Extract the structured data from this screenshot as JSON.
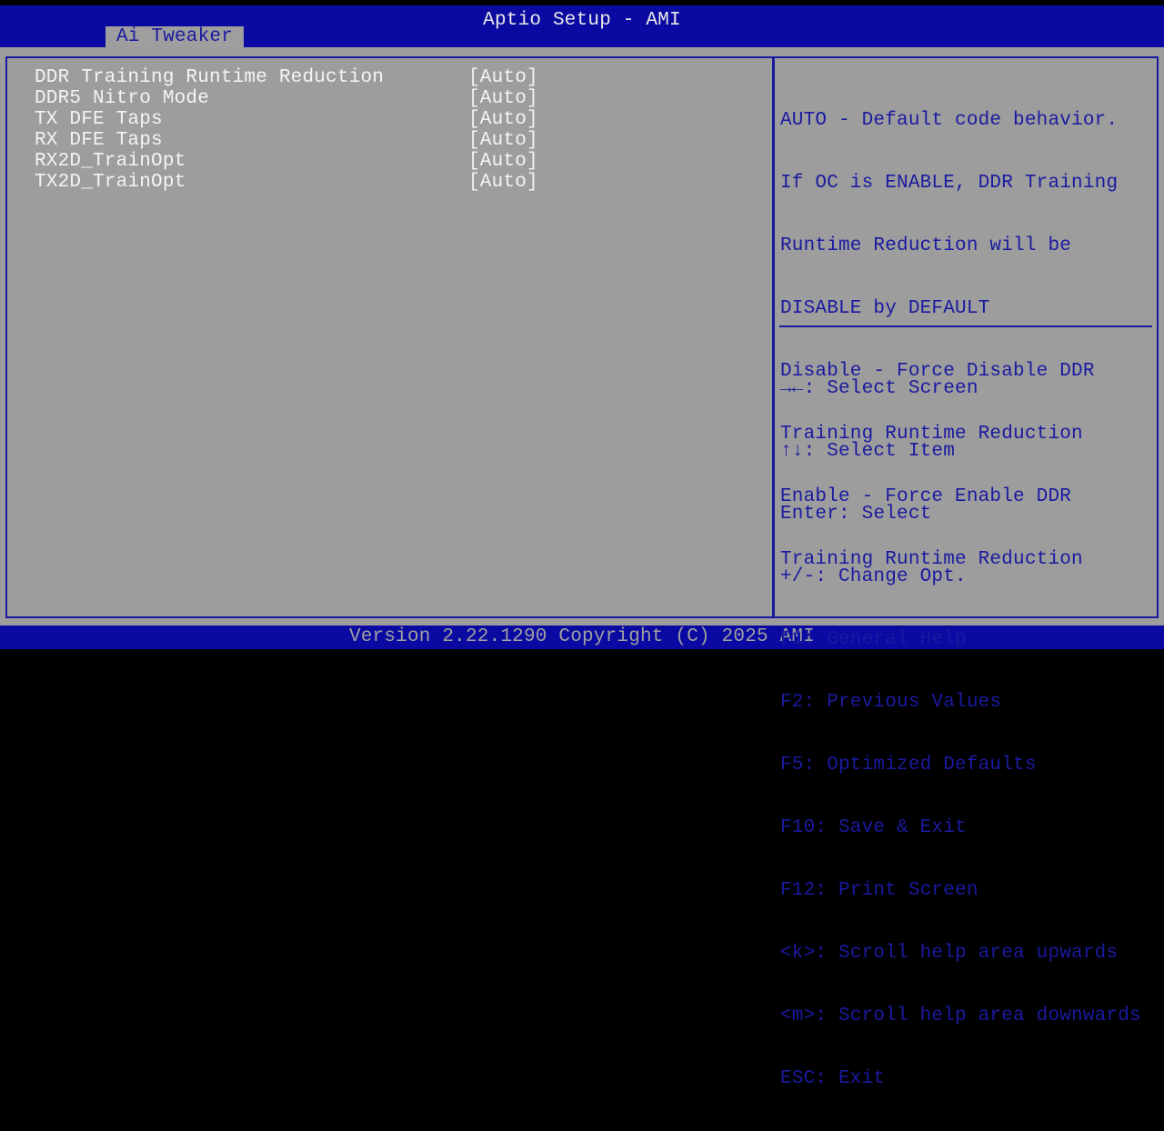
{
  "header": {
    "title": "Aptio Setup - AMI",
    "tab": "Ai Tweaker"
  },
  "settings": [
    {
      "label": "DDR Training Runtime Reduction",
      "value": "[Auto]"
    },
    {
      "label": "DDR5 Nitro Mode",
      "value": "[Auto]"
    },
    {
      "label": "TX DFE Taps",
      "value": "[Auto]"
    },
    {
      "label": "RX DFE Taps",
      "value": "[Auto]"
    },
    {
      "label": "RX2D_TrainOpt",
      "value": "[Auto]"
    },
    {
      "label": "TX2D_TrainOpt",
      "value": "[Auto]"
    }
  ],
  "help_text": [
    "AUTO - Default code behavior.",
    "If OC is ENABLE, DDR Training",
    "Runtime Reduction will be",
    "DISABLE by DEFAULT",
    "Disable - Force Disable DDR",
    "Training Runtime Reduction",
    "Enable - Force Enable DDR",
    "Training Runtime Reduction"
  ],
  "key_help": [
    "→←: Select Screen",
    "↑↓: Select Item",
    "Enter: Select",
    "+/-: Change Opt.",
    "F1: General Help",
    "F2: Previous Values",
    "F5: Optimized Defaults",
    "F10: Save & Exit",
    "F12: Print Screen",
    "<k>: Scroll help area upwards",
    "<m>: Scroll help area downwards",
    "ESC: Exit"
  ],
  "footer": "Version 2.22.1290 Copyright (C) 2025 AMI"
}
